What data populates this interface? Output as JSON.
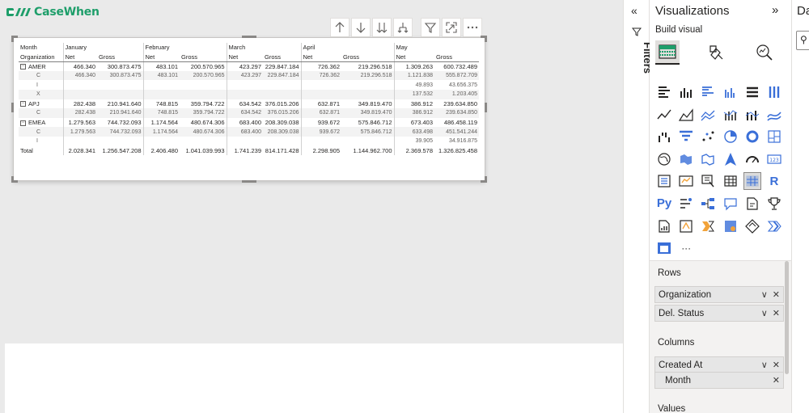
{
  "app": {
    "logo_text": "CaseWhen",
    "brand_color": "#1e9e6a"
  },
  "visual_toolbar": [
    "arrow-up-icon",
    "arrow-down-icon",
    "double-arrow-down-icon",
    "expand-hierarchy-icon",
    "filter-icon",
    "focus-mode-icon",
    "more-options-icon"
  ],
  "matrix": {
    "header": {
      "corner_top": "Month",
      "corner_bottom": "Organization",
      "months": [
        "January",
        "February",
        "March",
        "April",
        "May"
      ],
      "measures": [
        "Net",
        "Gross"
      ]
    },
    "rows": [
      {
        "label": "AMER",
        "level": 0,
        "expander": "⊟",
        "values": [
          "466.340",
          "300.873.475",
          "483.101",
          "200.570.965",
          "423.297",
          "229.847.184",
          "726.362",
          "219.296.518",
          "1.309.263",
          "600.732.489"
        ]
      },
      {
        "label": "C",
        "level": 1,
        "values": [
          "466.340",
          "300.873.475",
          "483.101",
          "200.570.965",
          "423.297",
          "229.847.184",
          "726.362",
          "219.296.518",
          "1.121.838",
          "555.872.709"
        ]
      },
      {
        "label": "I",
        "level": 1,
        "values": [
          "",
          "",
          "",
          "",
          "",
          "",
          "",
          "",
          "49.893",
          "43.656.375"
        ]
      },
      {
        "label": "X",
        "level": 1,
        "values": [
          "",
          "",
          "",
          "",
          "",
          "",
          "",
          "",
          "137.532",
          "1.203.405"
        ]
      },
      {
        "label": "APJ",
        "level": 0,
        "expander": "⊟",
        "values": [
          "282.438",
          "210.941.640",
          "748.815",
          "359.794.722",
          "634.542",
          "376.015.206",
          "632.871",
          "349.819.470",
          "386.912",
          "239.634.850"
        ]
      },
      {
        "label": "C",
        "level": 1,
        "values": [
          "282.438",
          "210.941.640",
          "748.815",
          "359.794.722",
          "634.542",
          "376.015.206",
          "632.871",
          "349.819.470",
          "386.912",
          "239.634.850"
        ]
      },
      {
        "label": "EMEA",
        "level": 0,
        "expander": "⊟",
        "values": [
          "1.279.563",
          "744.732.093",
          "1.174.564",
          "480.674.306",
          "683.400",
          "208.309.038",
          "939.672",
          "575.846.712",
          "673.403",
          "486.458.119"
        ]
      },
      {
        "label": "C",
        "level": 1,
        "values": [
          "1.279.563",
          "744.732.093",
          "1.174.564",
          "480.674.306",
          "683.400",
          "208.309.038",
          "939.672",
          "575.846.712",
          "633.498",
          "451.541.244"
        ]
      },
      {
        "label": "I",
        "level": 1,
        "values": [
          "",
          "",
          "",
          "",
          "",
          "",
          "",
          "",
          "39.905",
          "34.916.875"
        ]
      },
      {
        "label": "Total",
        "level": 0,
        "values": [
          "2.028.341",
          "1.256.547.208",
          "2.406.480",
          "1.041.039.993",
          "1.741.239",
          "814.171.428",
          "2.298.905",
          "1.144.962.700",
          "2.369.578",
          "1.326.825.458"
        ]
      }
    ]
  },
  "filters_strip": {
    "label": "Filters",
    "collapse_glyph": "«"
  },
  "visualizations": {
    "title": "Visualizations",
    "collapse_glyph": "»",
    "build_visual": "Build visual",
    "r_label": "R",
    "py_label": "Py",
    "more": "···"
  },
  "wells": {
    "rows_title": "Rows",
    "rows_fields": [
      "Organization",
      "Del. Status"
    ],
    "columns_title": "Columns",
    "columns_fields": [
      "Created At",
      "Month"
    ],
    "values_title": "Values",
    "field_controls": {
      "expand": "∨",
      "remove": "✕"
    }
  },
  "data_pane": {
    "title": "Da"
  }
}
